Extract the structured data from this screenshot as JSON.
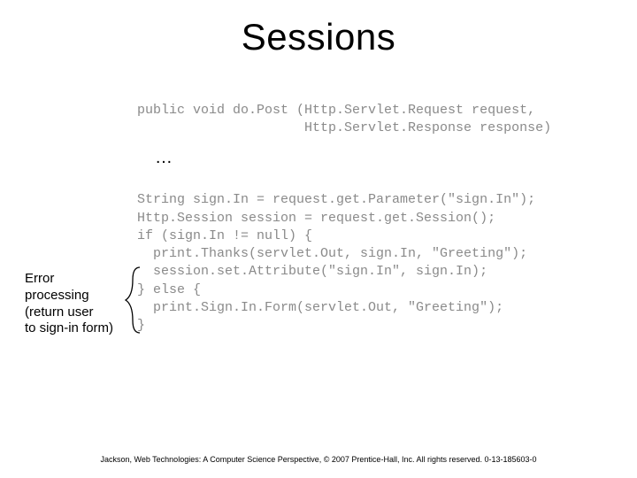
{
  "title": "Sessions",
  "code_line1": "public void do.Post (Http.Servlet.Request request,",
  "code_line2": "                     Http.Servlet.Response response)",
  "ellipsis": "…",
  "code_line3": "String sign.In = request.get.Parameter(\"sign.In\");",
  "code_line4": "Http.Session session = request.get.Session();",
  "code_line5": "if (sign.In != null) {",
  "code_line6": "  print.Thanks(servlet.Out, sign.In, \"Greeting\");",
  "code_line7": "  session.set.Attribute(\"sign.In\", sign.In);",
  "code_line8": "} else {",
  "code_line9": "  print.Sign.In.Form(servlet.Out, \"Greeting\");",
  "code_line10": "}",
  "annotation": "Error\nprocessing\n(return user\nto sign-in form)",
  "footer": "Jackson, Web Technologies: A Computer Science Perspective, © 2007 Prentice-Hall, Inc. All rights reserved. 0-13-185603-0"
}
